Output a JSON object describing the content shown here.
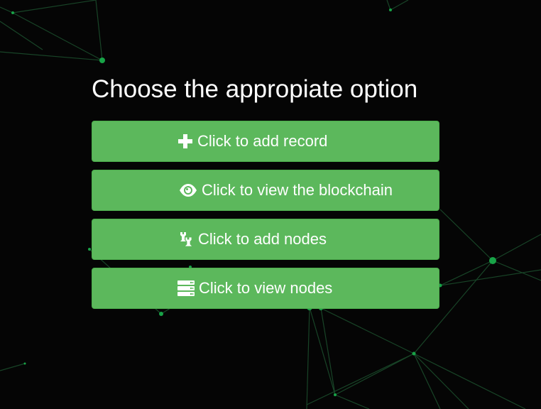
{
  "page": {
    "title": "Choose the appropiate option"
  },
  "options": [
    {
      "label": "Click to add record",
      "icon": "plus-icon"
    },
    {
      "label": "Click to view the blockchain",
      "icon": "eye-icon"
    },
    {
      "label": "Click to add nodes",
      "icon": "chess-rook-icon"
    },
    {
      "label": "Click to view nodes",
      "icon": "server-icon"
    }
  ],
  "colors": {
    "background": "#050505",
    "button": "#5cb85c",
    "button_border": "#4cae4c",
    "text": "#ffffff",
    "network_line": "#1f6b3a",
    "network_node": "#1aa34a"
  }
}
